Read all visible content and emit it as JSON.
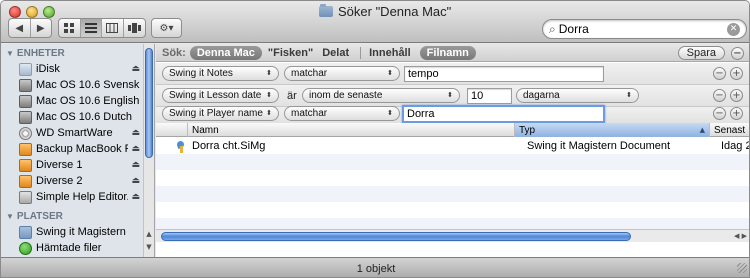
{
  "window": {
    "title": "Söker \"Denna Mac\""
  },
  "toolbar": {
    "back_glyph": "◀",
    "forward_glyph": "▶",
    "action_glyph": "⚙▾",
    "view_icons": [
      "icon-view-icon",
      "list-view-icon",
      "column-view-icon",
      "coverflow-view-icon"
    ],
    "active_view": "list"
  },
  "search": {
    "value": "Dorra",
    "icon": "magnifier-icon",
    "clear_glyph": "✕"
  },
  "sidebar": {
    "devices_header": "ENHETER",
    "devices": [
      {
        "label": "iDisk",
        "icon": "idisk-icon",
        "eject": true
      },
      {
        "label": "Mac OS 10.6 Svensk",
        "icon": "hard-disk-icon",
        "eject": false
      },
      {
        "label": "Mac OS 10.6 English",
        "icon": "hard-disk-icon",
        "eject": false
      },
      {
        "label": "Mac OS 10.6 Dutch",
        "icon": "hard-disk-icon",
        "eject": false
      },
      {
        "label": "WD SmartWare",
        "icon": "cd-icon",
        "eject": true
      },
      {
        "label": "Backup MacBook Pro",
        "icon": "external-disk-icon",
        "eject": true
      },
      {
        "label": "Diverse 1",
        "icon": "external-disk-icon",
        "eject": true
      },
      {
        "label": "Diverse 2",
        "icon": "external-disk-icon",
        "eject": true
      },
      {
        "label": "Simple Help Editor...",
        "icon": "disk-image-icon",
        "eject": true
      }
    ],
    "places_header": "PLATSER",
    "places": [
      {
        "label": "Swing it Magistern",
        "icon": "folder-icon"
      },
      {
        "label": "Hämtade filer",
        "icon": "downloads-icon"
      }
    ],
    "eject_glyph": "⏏"
  },
  "scope": {
    "label": "Sök:",
    "active": "Denna Mac",
    "option_fisken": "\"Fisken\"",
    "option_shared": "Delat",
    "content": "Innehåll",
    "filename_active": "Filnamn",
    "save_label": "Spara"
  },
  "criteria": [
    {
      "attribute": "Swing it Notes",
      "operator": "matchar",
      "value": "tempo"
    },
    {
      "attribute": "Swing it Lesson date",
      "connector": "är",
      "operator": "inom de senaste",
      "value": "10",
      "unit": "dagarna"
    },
    {
      "attribute": "Swing it Player name",
      "operator": "matchar",
      "value": "Dorra"
    }
  ],
  "columns": {
    "name": "Namn",
    "type": "Typ",
    "last": "Senast"
  },
  "results": [
    {
      "name": "Dorra cht.SiMg",
      "type": "Swing it Magistern Document",
      "last": "Idag 2"
    }
  ],
  "status": {
    "text": "1 objekt"
  },
  "colors": {
    "accent": "#6b9be0",
    "sidebar_bg": "#dee4ea",
    "scope_pill": "#888888"
  }
}
